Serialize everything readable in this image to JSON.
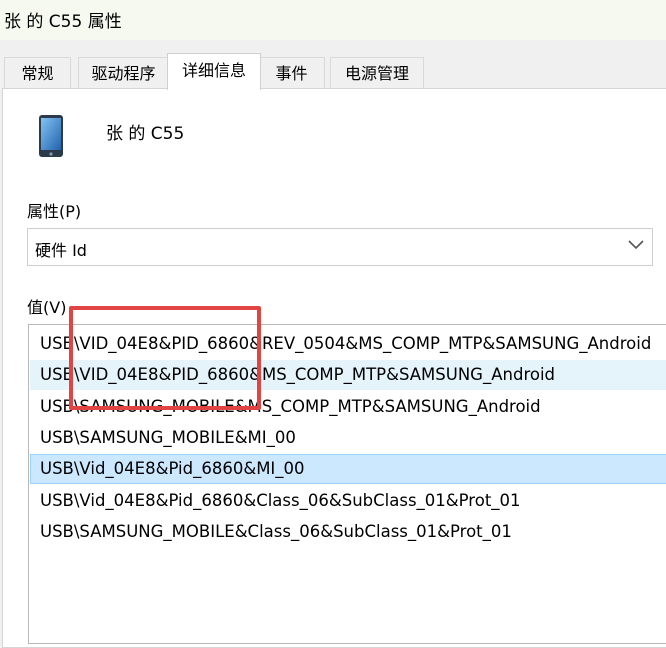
{
  "window": {
    "title": "张 的 C55 属性"
  },
  "tabs": [
    {
      "label": "常规"
    },
    {
      "label": "驱动程序"
    },
    {
      "label": "详细信息"
    },
    {
      "label": "事件"
    },
    {
      "label": "电源管理"
    }
  ],
  "device": {
    "name": "张 的 C55",
    "icon": "phone-icon"
  },
  "property": {
    "label": "属性(P)",
    "selected": "硬件 Id"
  },
  "value": {
    "label": "值(V)",
    "items": [
      "USB\\VID_04E8&PID_6860&REV_0504&MS_COMP_MTP&SAMSUNG_Android",
      "USB\\VID_04E8&PID_6860&MS_COMP_MTP&SAMSUNG_Android",
      "USB\\SAMSUNG_MOBILE&MS_COMP_MTP&SAMSUNG_Android",
      "USB\\SAMSUNG_MOBILE&MI_00",
      "USB\\Vid_04E8&Pid_6860&MI_00",
      "USB\\Vid_04E8&Pid_6860&Class_06&SubClass_01&Prot_01",
      "USB\\SAMSUNG_MOBILE&Class_06&SubClass_01&Prot_01"
    ],
    "hovered_index": 1,
    "selected_index": 4
  },
  "colors": {
    "selection": "#cce8ff",
    "hover": "#e5f3fb",
    "annotation": "#e24444"
  }
}
